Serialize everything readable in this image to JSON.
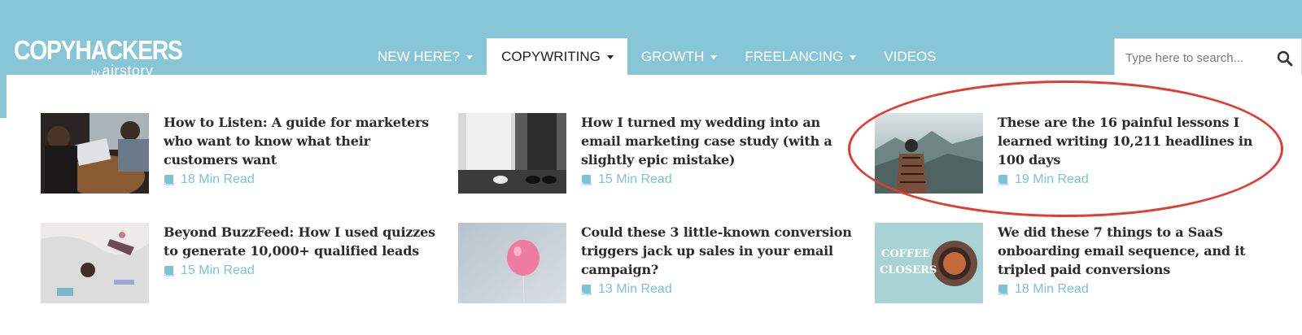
{
  "logo": {
    "main": "COPYHACKERS",
    "by": "by",
    "sub": "airstory"
  },
  "nav": [
    {
      "label": "NEW HERE?",
      "dropdown": true,
      "active": false
    },
    {
      "label": "COPYWRITING",
      "dropdown": true,
      "active": true
    },
    {
      "label": "GROWTH",
      "dropdown": true,
      "active": false
    },
    {
      "label": "FREELANCING",
      "dropdown": true,
      "active": false
    },
    {
      "label": "VIDEOS",
      "dropdown": false,
      "active": false
    }
  ],
  "search": {
    "placeholder": "Type here to search...",
    "icon": "search-icon"
  },
  "articles": [
    {
      "title": "How to Listen: A guide for marketers who want to know what their customers want",
      "read_time": "18 Min Read",
      "icon": "book-icon"
    },
    {
      "title": "How I turned my wedding into an email marketing case study (with a slightly epic mistake)",
      "read_time": "15 Min Read",
      "icon": "book-icon"
    },
    {
      "title": "These are the 16 painful lessons I learned writing 10,211 headlines in 100 days",
      "read_time": "19 Min Read",
      "icon": "book-icon",
      "highlighted": true
    },
    {
      "title": "Beyond BuzzFeed: How I used quizzes to generate 10,000+ qualified leads",
      "read_time": "15 Min Read",
      "icon": "book-icon"
    },
    {
      "title": "Could these 3 little-known conversion triggers jack up sales in your email campaign?",
      "read_time": "13 Min Read",
      "icon": "book-icon"
    },
    {
      "title": "We did these 7 things to a SaaS onboarding email sequence, and it tripled paid conversions",
      "read_time": "18 Min Read",
      "icon": "book-icon"
    }
  ],
  "thumb_text": {
    "coffee_line1": "COFFEE",
    "coffee_line2": "CLOSERS"
  },
  "colors": {
    "header": "#86c6d6",
    "accent": "#7cc3d5",
    "highlight_circle": "#e53a2f"
  }
}
